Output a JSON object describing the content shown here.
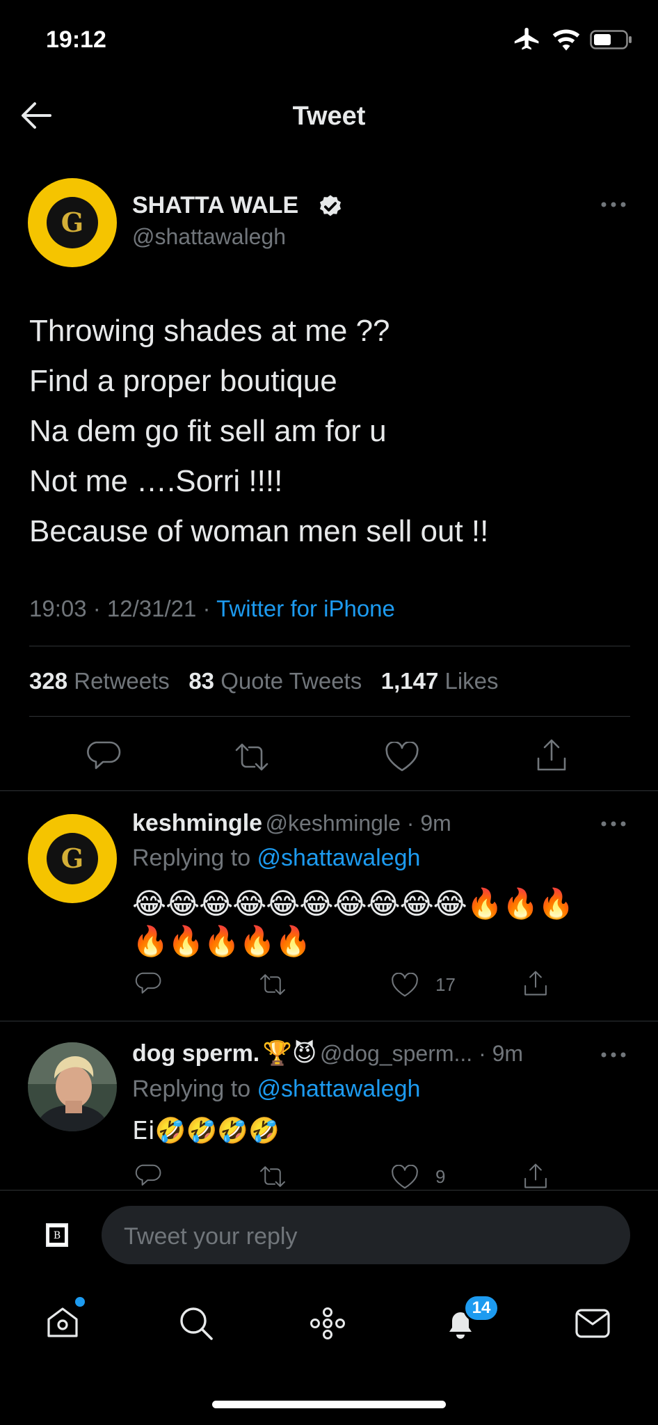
{
  "status_bar": {
    "time": "19:12"
  },
  "header": {
    "title": "Tweet"
  },
  "tweet": {
    "author_name": "SHATTA WALE",
    "author_handle": "@shattawalegh",
    "avatar_letter": "G",
    "lines": [
      "Throwing shades at me ??",
      "Find a proper boutique",
      "Na dem go fit sell am for u",
      "Not me ….Sorri !!!!",
      "Because of woman men sell out !!"
    ],
    "meta_time": "19:03 · 12/31/21 · ",
    "meta_source": "Twitter for iPhone",
    "retweets": "328",
    "retweets_label": "Retweets",
    "quotes": "83",
    "quotes_label": "Quote Tweets",
    "likes": "1,147",
    "likes_label": "Likes"
  },
  "replies": [
    {
      "name": "keshmingle",
      "handle_time": "@keshmingle · 9m",
      "replying_prefix": "Replying to ",
      "replying_handle": "@shattawalegh",
      "avatar_letter": "G",
      "content_line1": "😂😂😂😂😂😂😂😂😂😂🔥🔥🔥",
      "content_line2": "🔥🔥🔥🔥🔥",
      "like_count": "17"
    },
    {
      "name": "dog sperm.",
      "name_emojis": "🏆😈",
      "handle_time": "@dog_sperm... · 9m",
      "replying_prefix": "Replying to ",
      "replying_handle": "@shattawalegh",
      "content_line1": "Ei🤣🤣🤣🤣",
      "like_count": "9"
    }
  ],
  "composer": {
    "placeholder": "Tweet your reply"
  },
  "tabbar": {
    "notifications_badge": "14"
  },
  "colors": {
    "accent": "#1d9bf0",
    "background": "#000000",
    "muted": "#71767b",
    "avatar_yellow": "#f5c400"
  }
}
